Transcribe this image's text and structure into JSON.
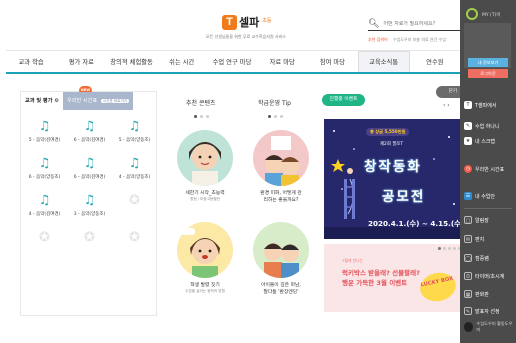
{
  "header": {
    "logo_text": "셀파",
    "logo_sub": "초등",
    "tagline": "모든 선생님들을 위한 무료 교수학습지원 서비스",
    "search_placeholder": "어떤 자료가 필요하세요?",
    "keywords_label": "추천 검색어",
    "keywords": "수업도우미  보충 의료  연간 수업"
  },
  "nav": {
    "items": [
      "교과 학습",
      "평가 자료",
      "창의적 체험활동",
      "쉬는 시간",
      "수업 연구 마당",
      "자료 마당",
      "참여 마당",
      "교육소식통",
      "연수원"
    ]
  },
  "left_panel": {
    "tab1": "교과 및 평가",
    "tab1_icon": "settings",
    "tab2": "우리반 시간표",
    "tab2_chip": "시간표 바로가기",
    "new_badge": "NEW",
    "cells": [
      {
        "label": "5 - 음악(김여경)",
        "filled": true
      },
      {
        "label": "6 - 음악(김여경)",
        "filled": true
      },
      {
        "label": "5 - 음악(양동조)",
        "filled": true
      },
      {
        "label": "6 - 음악(양동조)",
        "filled": true
      },
      {
        "label": "6 - 음악(김여경)",
        "filled": true
      },
      {
        "label": "4 - 음악(양동조)",
        "filled": true
      },
      {
        "label": "4 - 음악(김여경)",
        "filled": true
      },
      {
        "label": "3 - 음악(양동조)",
        "filled": true
      },
      {
        "label": "",
        "filled": false
      },
      {
        "label": "",
        "filled": false
      },
      {
        "label": "",
        "filled": false
      },
      {
        "label": "",
        "filled": false
      }
    ]
  },
  "recommended": {
    "title": "추천 콘텐츠",
    "cards": [
      {
        "caption": "세한기 시작_초능력",
        "sub": "청정 / 미중고등혈안"
      },
      {
        "caption": "학생 발령 짓기",
        "sub": "수업을 살리는 동작의 방법"
      }
    ]
  },
  "tips": {
    "title": "학급운영 Tip",
    "cards": [
      {
        "caption": "환경 미화, 어떻게 관",
        "caption2": "리하는 좋을까요?"
      },
      {
        "caption": "아이들이 깊은 마남,",
        "caption2": "말다툼 '환장엔딩'"
      }
    ]
  },
  "events": {
    "tab": "진행중 이벤트",
    "pager": "‹ ›",
    "fold": "닫기",
    "banner1": {
      "prize": "총 상금 5,550만원",
      "subtitle": "제2회 필쪼T",
      "line1": "창작동화",
      "line2": "공모전",
      "dates": "2020.4.1.(수) ~ 4.15.(수)"
    },
    "banner2": {
      "small": "7월에 만나는",
      "line1": "럭키박스 받을래? 선물할래?",
      "line2": "행운 가득한 3월 이벤트",
      "lucky": "LUCKY BOX"
    }
  },
  "sidebar": {
    "my_t": "MY (T)이",
    "btn1": "내 정보보기",
    "btn2": "로그아웃",
    "items": [
      {
        "label": "T셀파에서",
        "icon": "tsellpa"
      },
      {
        "label": "수업 하나니",
        "icon": "class"
      },
      {
        "label": "내 스크랩",
        "icon": "scrap"
      },
      {
        "label": "우리반 시간표",
        "icon": "clock"
      },
      {
        "label": "내 수업안",
        "icon": "note"
      },
      {
        "label": "알림장",
        "icon": "notice"
      },
      {
        "label": "편지",
        "icon": "mail"
      },
      {
        "label": "점중램",
        "icon": "timer"
      },
      {
        "label": "타이머/초시계",
        "icon": "stopwatch"
      },
      {
        "label": "판화판",
        "icon": "board"
      },
      {
        "label": "발표자 선정",
        "icon": "pick"
      }
    ],
    "bottom": "수업도우미 활동도우미"
  }
}
